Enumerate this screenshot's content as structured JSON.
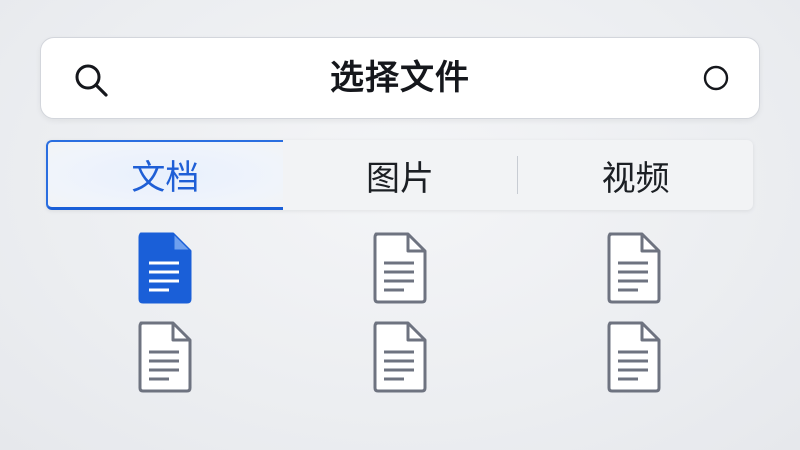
{
  "header": {
    "title": "选择文件",
    "search_icon": "search-icon",
    "status_icon": "circle-icon"
  },
  "tabs": [
    {
      "label": "文档",
      "active": true
    },
    {
      "label": "图片",
      "active": false
    },
    {
      "label": "视频",
      "active": false
    }
  ],
  "files": [
    {
      "icon": "document-icon",
      "selected": true
    },
    {
      "icon": "document-icon",
      "selected": false
    },
    {
      "icon": "document-icon",
      "selected": false
    },
    {
      "icon": "document-icon",
      "selected": false
    },
    {
      "icon": "document-icon",
      "selected": false
    },
    {
      "icon": "document-icon",
      "selected": false
    }
  ],
  "colors": {
    "accent": "#1a5fd8",
    "icon_gray": "#6e7380"
  }
}
